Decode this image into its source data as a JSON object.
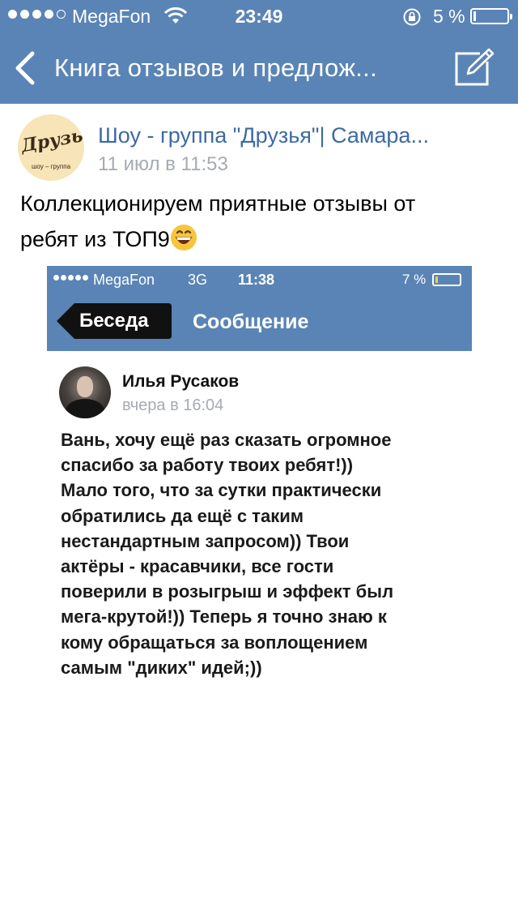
{
  "status_bar": {
    "carrier": "MegaFon",
    "time": "23:49",
    "battery_percent": "5 %",
    "battery_level": 0.05,
    "signal_bars": 4
  },
  "nav": {
    "back_icon": "chevron-left-icon",
    "title": "Книга отзывов и предлож...",
    "compose_icon": "compose-icon"
  },
  "post": {
    "group_name": "Шоу - группа \"Друзья\"| Самара...",
    "date": "11 июл в 11:53",
    "text_line1": "Коллекционируем приятные отзывы от",
    "text_line2": "ребят из ТОП9",
    "emoji": "grinning-face-emoji",
    "avatar": {
      "logo": "Друзья",
      "subtitle": "шоу – группа"
    }
  },
  "embedded_screenshot": {
    "status_bar": {
      "carrier": "MegaFon",
      "network": "3G",
      "time": "11:38",
      "battery_percent": "7 %",
      "battery_level": 0.07
    },
    "back_label": "Беседа",
    "title": "Сообщение",
    "author": "Илья Русаков",
    "date": "вчера в 16:04",
    "message_lines": [
      "Вань, хочу ещё раз сказать огромное",
      "спасибо за работу твоих ребят!))",
      "Мало того, что за сутки практически",
      "обратились да ещё с таким",
      "нестандартным запросом)) Твои",
      "актёры - красавчики, все гости",
      "поверили в розыгрыш и эффект был",
      "мега-крутой!)) Теперь я точно знаю к",
      "кому обращаться за воплощением",
      "самым \"диких\" идей;))"
    ]
  },
  "colors": {
    "nav_blue": "#5a84b5",
    "link_blue": "#3d6aa2",
    "secondary_gray": "#a6abb2"
  }
}
